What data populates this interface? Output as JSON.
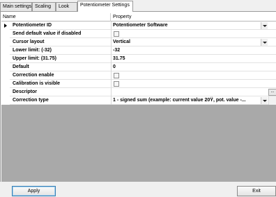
{
  "tabs": [
    {
      "label": "Main settings",
      "active": false
    },
    {
      "label": "Scaling",
      "active": false
    },
    {
      "label": "Look",
      "active": false
    },
    {
      "label": "Potentiometer Settings",
      "active": true
    }
  ],
  "grid": {
    "columns": {
      "name": "Name",
      "property": "Property"
    },
    "rows": [
      {
        "label": "Potentiometer ID",
        "value": "Potentiometer Software",
        "kind": "dropdown",
        "expander": true
      },
      {
        "label": "Send default value if disabled",
        "value": "",
        "kind": "checkbox",
        "checked": false
      },
      {
        "label": "Cursor layout",
        "value": "Vertical",
        "kind": "dropdown"
      },
      {
        "label": "Lower limit: (-32)",
        "value": "-32",
        "kind": "text"
      },
      {
        "label": "Upper limit: (31.75)",
        "value": "31.75",
        "kind": "text"
      },
      {
        "label": "Default",
        "value": "0",
        "kind": "text"
      },
      {
        "label": "Correction enable",
        "value": "",
        "kind": "checkbox",
        "checked": false
      },
      {
        "label": "Calibration is visible",
        "value": "",
        "kind": "checkbox",
        "checked": false
      },
      {
        "label": "Descriptor",
        "value": "",
        "kind": "text-ellipsis",
        "button": "..."
      },
      {
        "label": "Correction type",
        "value": "1 - signed sum (example: current value 20Ÿ, pot. value -...",
        "kind": "dropdown"
      }
    ]
  },
  "buttons": {
    "apply": "Apply",
    "exit": "Exit"
  }
}
